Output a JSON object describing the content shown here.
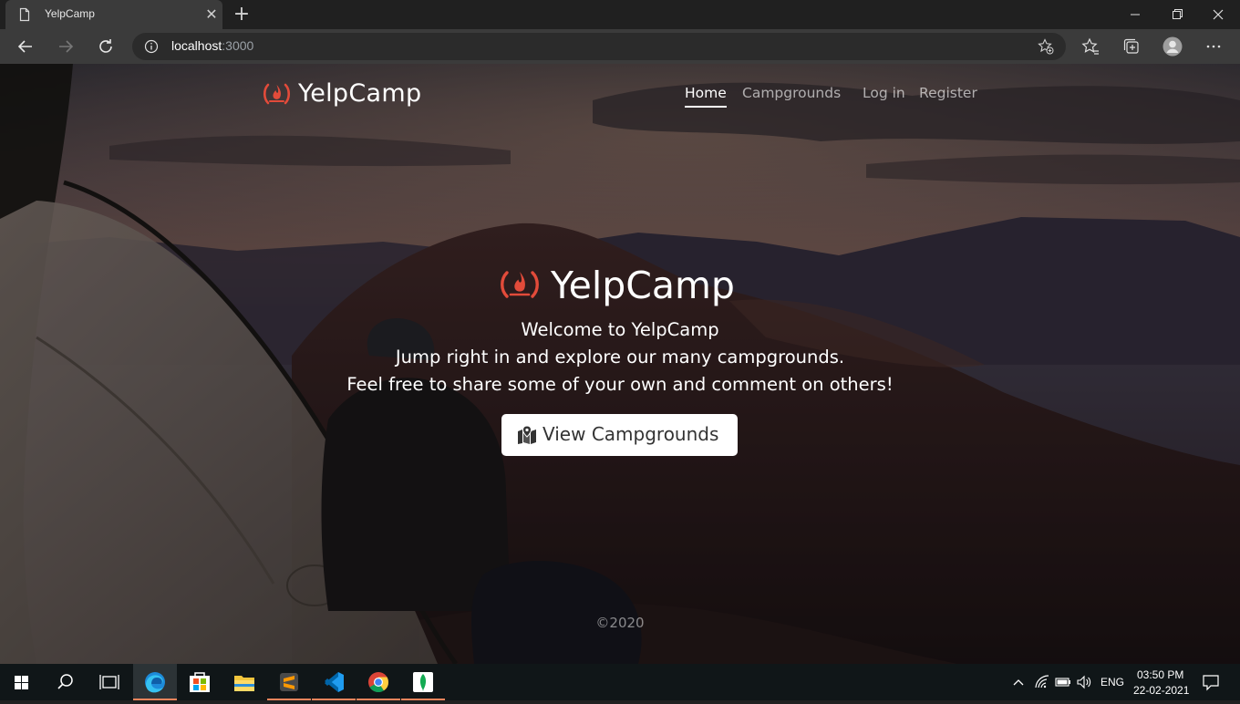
{
  "browser": {
    "tab": {
      "title": "YelpCamp",
      "close_symbol": "✕"
    },
    "new_tab_symbol": "+",
    "address": {
      "host": "localhost",
      "port": ":3000"
    }
  },
  "site": {
    "brand": "YelpCamp",
    "nav": [
      {
        "label": "Home",
        "active": true
      },
      {
        "label": "Campgrounds",
        "active": false
      },
      {
        "label": "Log in",
        "active": false
      },
      {
        "label": "Register",
        "active": false
      }
    ],
    "hero": {
      "title": "YelpCamp",
      "lines": [
        "Welcome to YelpCamp",
        "Jump right in and explore our many campgrounds.",
        "Feel free to share some of your own and comment on others!"
      ],
      "cta_label": "View Campgrounds"
    },
    "footer": "©2020",
    "accent_color": "#e24b3a"
  },
  "taskbar": {
    "apps": [
      "start-icon",
      "search-icon",
      "task-view-icon",
      "edge-icon",
      "store-icon",
      "file-explorer-icon",
      "sublime-text-icon",
      "vscode-icon",
      "chrome-icon",
      "mongodb-compass-icon"
    ],
    "language": "ENG",
    "time": "03:50 PM",
    "date": "22-02-2021"
  }
}
